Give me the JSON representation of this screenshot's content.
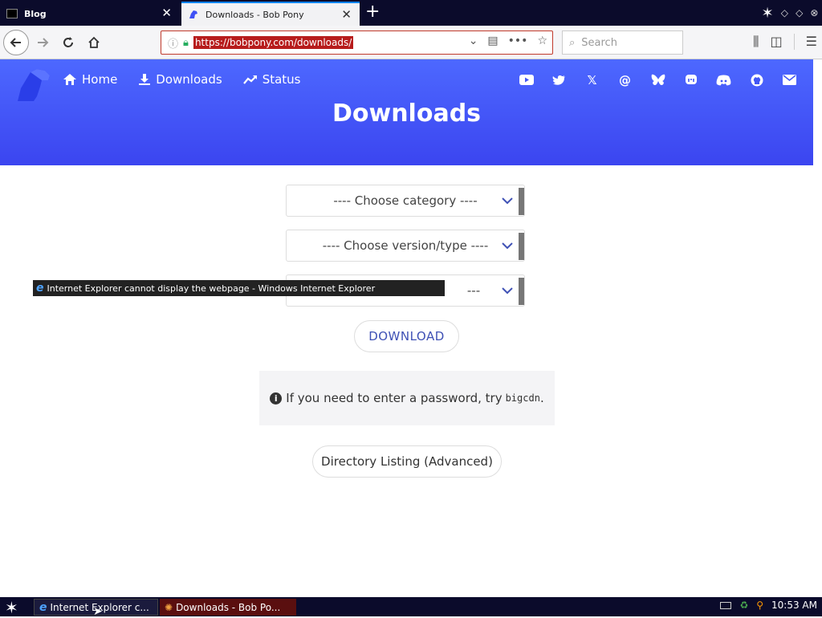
{
  "browser": {
    "tabs": [
      {
        "title": "Blog",
        "close": "✕"
      },
      {
        "title": "Downloads - Bob Pony",
        "close": "✕",
        "active": true
      }
    ],
    "new_tab": "+",
    "url": "https://bobpony.com/downloads/",
    "search_placeholder": "Search"
  },
  "site": {
    "nav": [
      {
        "label": "Home",
        "icon": "home-icon"
      },
      {
        "label": "Downloads",
        "icon": "download-icon"
      },
      {
        "label": "Status",
        "icon": "trend-icon"
      }
    ],
    "social_icons": [
      "youtube-icon",
      "twitter-icon",
      "x-icon",
      "threads-icon",
      "bluesky-icon",
      "mastodon-icon",
      "discord-icon",
      "github-icon",
      "mail-icon"
    ],
    "page_title": "Downloads",
    "header_color": "#4257f5"
  },
  "content": {
    "select_category": "---- Choose category ----",
    "select_version": "---- Choose version/type ----",
    "select_third": "---",
    "download_label": "DOWNLOAD",
    "notice_text": "If you need to enter a password, try",
    "notice_password": "bigcdn",
    "notice_end": ".",
    "dir_listing": "Directory Listing (Advanced)"
  },
  "overlay": {
    "ie_title": "Internet Explorer cannot display the webpage - Windows Internet Explorer"
  },
  "taskbar": {
    "items": [
      {
        "label": "Internet Explorer c..."
      },
      {
        "label": "Downloads - Bob Po..."
      }
    ],
    "clock": "10:53 AM"
  }
}
